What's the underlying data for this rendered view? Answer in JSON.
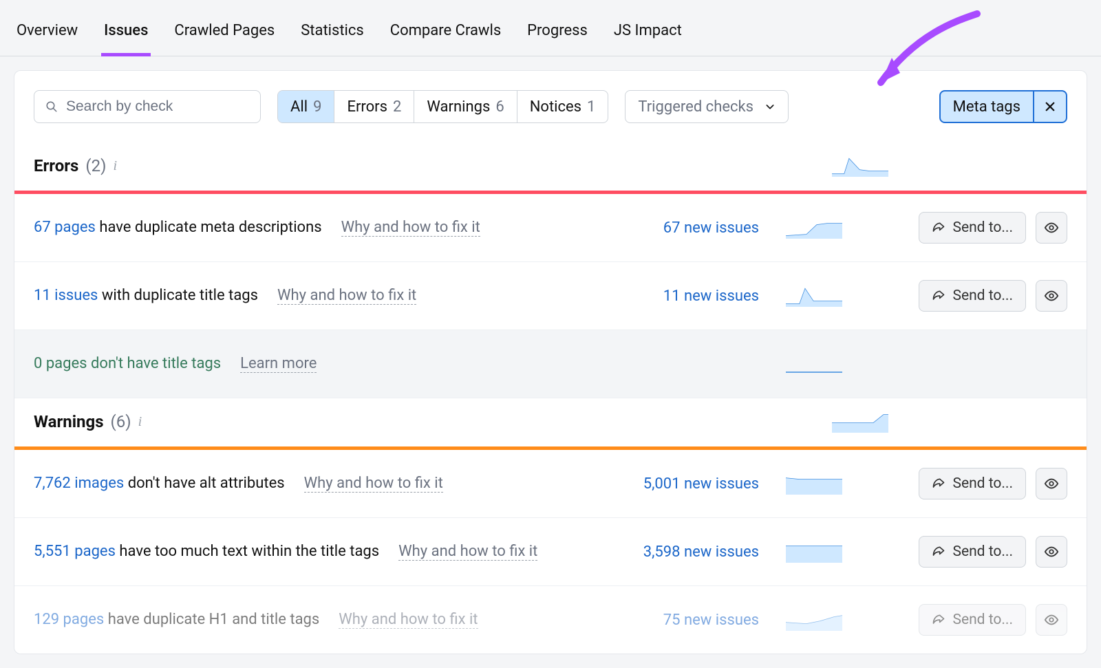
{
  "tabs": [
    "Overview",
    "Issues",
    "Crawled Pages",
    "Statistics",
    "Compare Crawls",
    "Progress",
    "JS Impact"
  ],
  "active_tab_index": 1,
  "search": {
    "placeholder": "Search by check"
  },
  "segments": [
    {
      "label": "All",
      "count": 9,
      "active": true
    },
    {
      "label": "Errors",
      "count": 2,
      "active": false
    },
    {
      "label": "Warnings",
      "count": 6,
      "active": false
    },
    {
      "label": "Notices",
      "count": 1,
      "active": false
    }
  ],
  "triggered_dropdown": {
    "label": "Triggered checks"
  },
  "filter_chip": {
    "label": "Meta tags"
  },
  "sections": {
    "errors": {
      "title": "Errors",
      "count": "(2)"
    },
    "warnings": {
      "title": "Warnings",
      "count": "(6)"
    }
  },
  "buttons": {
    "send_to": "Send to..."
  },
  "why_label": "Why and how to fix it",
  "learn_more_label": "Learn more",
  "errors": [
    {
      "count_link": "67 pages",
      "text": "have duplicate meta descriptions",
      "new": "67 new issues",
      "active": true
    },
    {
      "count_link": "11 issues",
      "text": "with duplicate title tags",
      "new": "11 new issues",
      "active": true
    },
    {
      "count_link": "0 pages",
      "text": "don't have title tags",
      "new": "",
      "active": false
    }
  ],
  "warnings": [
    {
      "count_link": "7,762 images",
      "text": "don't have alt attributes",
      "new": "5,001 new issues",
      "active": true
    },
    {
      "count_link": "5,551 pages",
      "text": "have too much text within the title tags",
      "new": "3,598 new issues",
      "active": true
    },
    {
      "count_link": "129 pages",
      "text": "have duplicate H1 and title tags",
      "new": "75 new issues",
      "active": true
    }
  ]
}
